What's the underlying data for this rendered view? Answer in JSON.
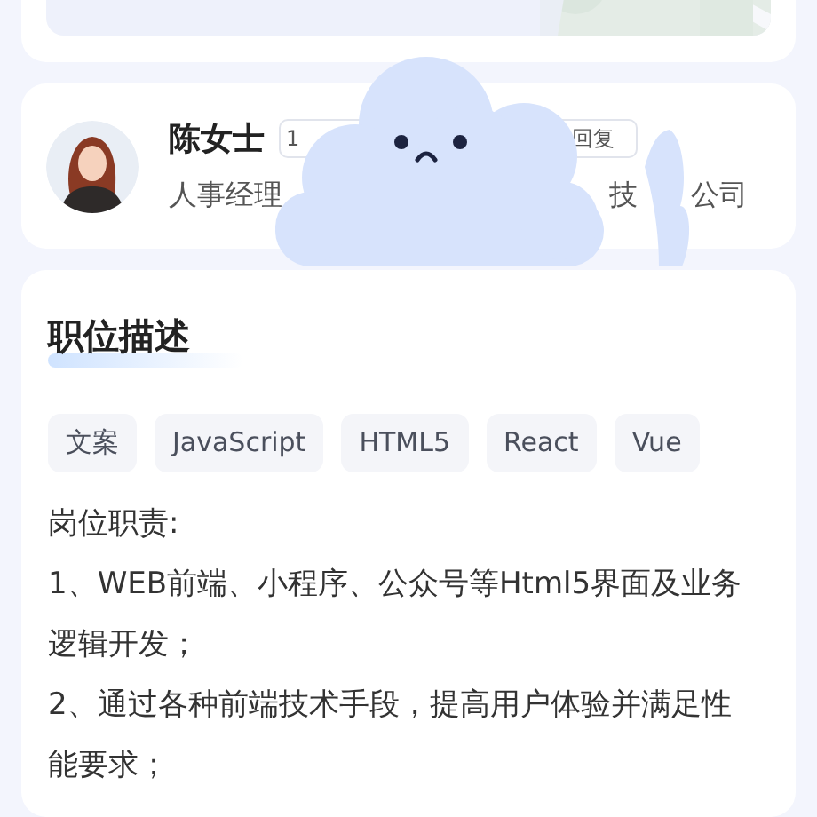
{
  "recruiter": {
    "name": "陈女士",
    "badge_start": "1",
    "badge_end": "回复",
    "title_parts": [
      "人事经理",
      "技",
      "公司"
    ]
  },
  "description": {
    "title": "职位描述",
    "tags": [
      "文案",
      "JavaScript",
      "HTML5",
      "React",
      "Vue"
    ],
    "lines": [
      "岗位职责:",
      "1、WEB前端、小程序、公众号等Html5界面及业务逻辑开发；",
      "2、通过各种前端技术手段，提高用户体验并满足性能要求；"
    ]
  }
}
